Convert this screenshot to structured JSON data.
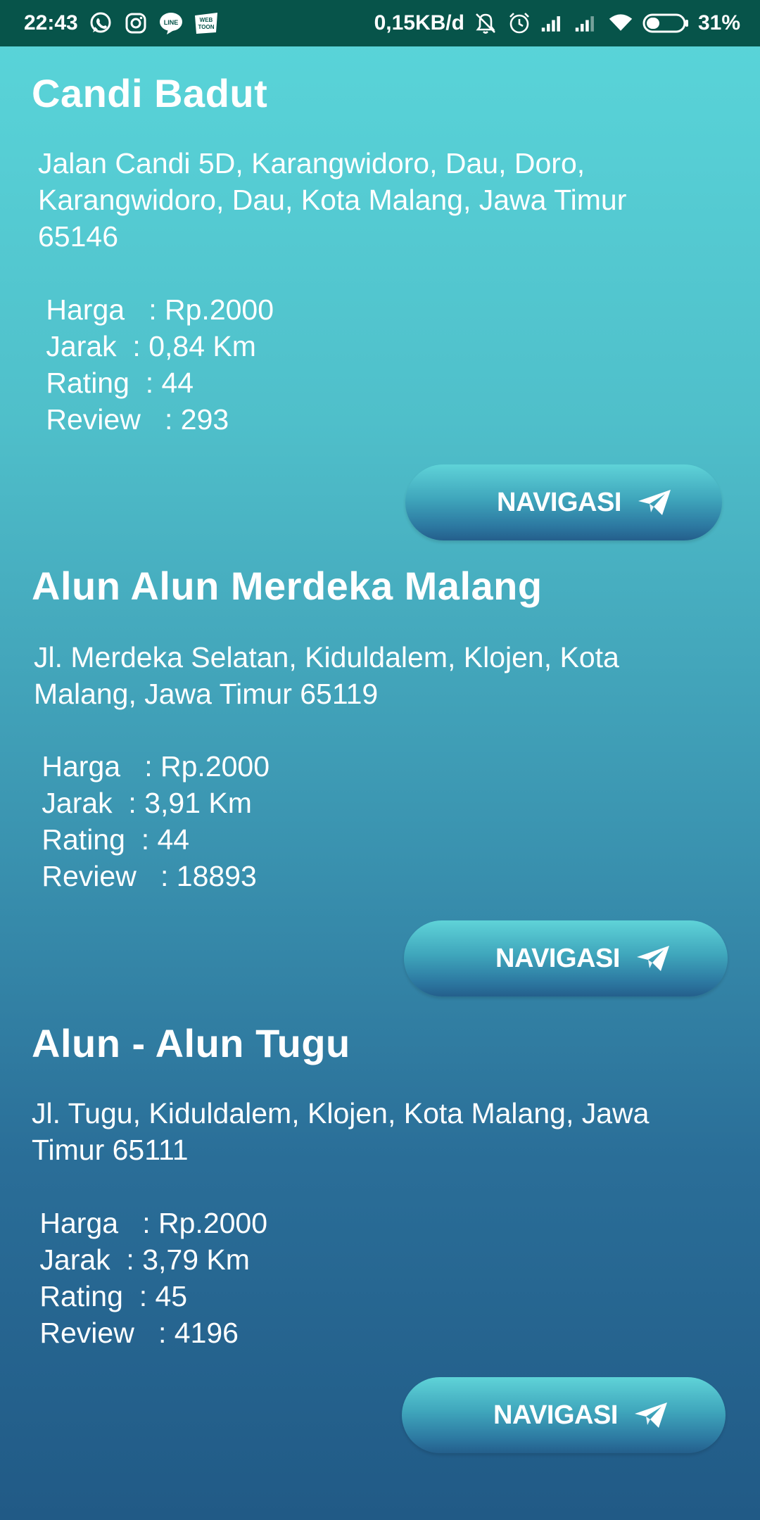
{
  "status_bar": {
    "time": "22:43",
    "network_speed": "0,15KB/d",
    "battery": "31%",
    "left_icons": [
      "whatsapp-icon",
      "instagram-icon",
      "line-icon",
      "webtoon-icon"
    ],
    "webtoon_text": "WEB TOON",
    "line_text": "LINE",
    "right_icons": [
      "mute-notification-icon",
      "alarm-icon",
      "signal-icon",
      "signal-icon",
      "wifi-icon",
      "battery-icon"
    ]
  },
  "places": [
    {
      "title": "Candi Badut",
      "address": "Jalan Candi 5D, Karangwidoro, Dau, Doro, Karangwidoro, Dau, Kota Malang, Jawa Timur 65146",
      "harga": " Harga   : Rp.2000",
      "jarak": " Jarak  : 0,84 Km",
      "rating": " Rating  : 44",
      "review": " Review   : 293",
      "button_label": "NAVIGASI"
    },
    {
      "title": "Alun Alun Merdeka Malang",
      "address": "Jl. Merdeka Selatan, Kiduldalem, Klojen, Kota Malang, Jawa Timur 65119",
      "harga": " Harga   : Rp.2000",
      "jarak": " Jarak  : 3,91 Km",
      "rating": " Rating  : 44",
      "review": " Review   : 18893",
      "button_label": "NAVIGASI"
    },
    {
      "title": "Alun - Alun Tugu",
      "address": "Jl. Tugu, Kiduldalem, Klojen, Kota Malang, Jawa Timur 65111",
      "harga": " Harga   : Rp.2000",
      "jarak": " Jarak  : 3,79 Km",
      "rating": " Rating  : 45",
      "review": " Review   : 4196",
      "button_label": "NAVIGASI"
    }
  ],
  "colors": {
    "status_bar_bg": "#07544a",
    "background_top": "#5ad6da",
    "background_bottom": "#215a86",
    "text": "#ffffff"
  }
}
